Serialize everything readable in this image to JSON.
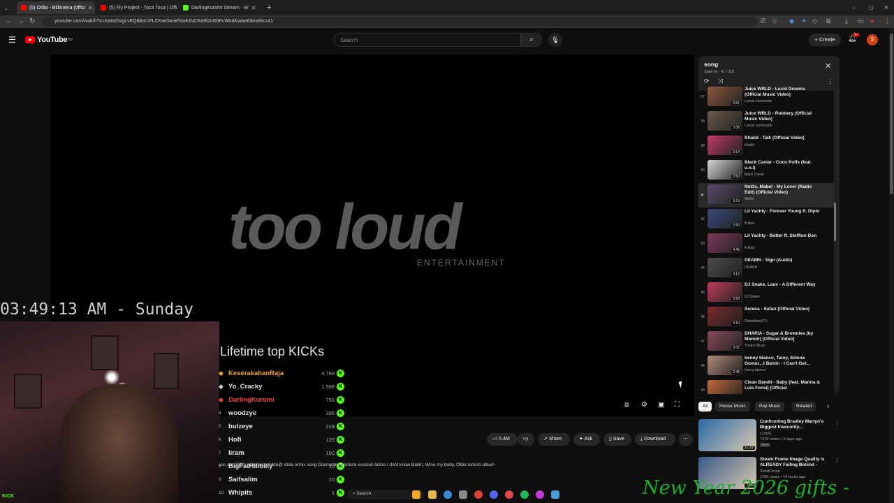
{
  "browser": {
    "tabs": [
      {
        "label": "(5) Otilia - Billionera (offici",
        "active": true,
        "color": "#ff0000"
      },
      {
        "label": "(5) Fly Project - Toca Toca | Offi",
        "active": false,
        "color": "#ff0000"
      },
      {
        "label": "DarlingKuromi Stream - W",
        "active": false,
        "color": "#53fc18"
      }
    ],
    "url": "youtube.com/watch?v=XataOVgLvEQ&list=PLCKwt34oefXwKINCRa9GoG5FcWk4KwAe6&index=41"
  },
  "header": {
    "logo_text": "YouTube",
    "logo_region": "BD",
    "search_placeholder": "Search",
    "create_label": "Create",
    "notification_count": "9+",
    "avatar_letter": "S"
  },
  "player": {
    "logo_main": "too loud",
    "logo_sub": "ENTERTAINMENT"
  },
  "overlay": {
    "clock": "03:49:13 AM - Sunday",
    "kick_tag": "KICK",
    "leaderboard_title": "Lifetime top KICKs",
    "leaderboard": [
      {
        "rank": "",
        "name": "KeserakahanRaja",
        "value": "4,768",
        "color": "#f5a623"
      },
      {
        "rank": "",
        "name": "Yo_Cracky",
        "value": "1,588",
        "color": "#e6e6e6"
      },
      {
        "rank": "",
        "name": "DarlingKuromi",
        "value": "756",
        "color": "#ff3b3b"
      },
      {
        "rank": "4",
        "name": "woodzye",
        "value": "396",
        "color": "#e6e6e6"
      },
      {
        "rank": "5",
        "name": "bulzeye",
        "value": "228",
        "color": "#e6e6e6"
      },
      {
        "rank": "6",
        "name": "Hofi",
        "value": "125",
        "color": "#e6e6e6"
      },
      {
        "rank": "7",
        "name": "Iiram",
        "value": "100",
        "color": "#e6e6e6"
      },
      {
        "rank": "8",
        "name": "BigFatHillbilly",
        "value": "10",
        "color": "#e6e6e6"
      },
      {
        "rank": "9",
        "name": "Saifsalim",
        "value": "10",
        "color": "#e6e6e6"
      },
      {
        "rank": "10",
        "name": "Whipits",
        "value": "1",
        "color": "#e6e6e6"
      }
    ],
    "new_year_text": "New Year 2026 gifts -"
  },
  "actions": {
    "likes": "5.4M",
    "share": "Share",
    "ask": "Ask",
    "save": "Save",
    "download": "Download"
  },
  "description_tags": "isic car 2020: billionaire Adda@ otilia remix song Diamante Aventura evocion latina I dont know Balim, Wine my body, Otilia turkish album",
  "playlist": {
    "title": "song",
    "subtitle": "Sajid sk - 41 / 101",
    "items": [
      {
        "num": "37",
        "title": "Juice WRLD - Lucid Dreams (Official Music Video)",
        "channel": "Lyrical Lemonade",
        "duration": "3:51",
        "color": "#8a5a3c"
      },
      {
        "num": "38",
        "title": "Juice WRLD - Robbery (Official Music Video)",
        "channel": "Lyrical Lemonade",
        "duration": "3:58",
        "color": "#6b5a4a"
      },
      {
        "num": "39",
        "title": "Khalid - Talk (Official Video)",
        "channel": "Khalid",
        "duration": "3:14",
        "color": "#c23a6a"
      },
      {
        "num": "40",
        "title": "Black Caviar - Coco Puffs (feat. u.n.i)",
        "channel": "Black Caviar",
        "duration": "2:50",
        "color": "#d8d8d8"
      },
      {
        "num": "▶",
        "title": "Not3s, Mabel - My Lover (Radio Edit) (Official Video)",
        "channel": "Not3s",
        "duration": "3:19",
        "color": "#5a4a6a"
      },
      {
        "num": "42",
        "title": "Lil Yachty - Forever Young ft. Diplo",
        "channel": "lil boat",
        "duration": "2:50",
        "color": "#3a4a7a"
      },
      {
        "num": "43",
        "title": "Lil Yachty - Better ft. Stefflon Don",
        "channel": "lil boat",
        "duration": "4:45",
        "color": "#7a3a5a"
      },
      {
        "num": "44",
        "title": "DEAMN - Sign (Audio)",
        "channel": "DEAMN",
        "duration": "3:12",
        "color": "#4a4a4a"
      },
      {
        "num": "45",
        "title": "DJ Snake, Lauv - A Different Way",
        "channel": "DJ Snake",
        "duration": "3:58",
        "color": "#c03a5a"
      },
      {
        "num": "46",
        "title": "Serena - Safari (Official Video)",
        "channel": "RotonMusicTV",
        "duration": "3:10",
        "color": "#7a2a2a"
      },
      {
        "num": "47",
        "title": "DHARIA - Sugar & Brownies (by Monoir) [Official Video]",
        "channel": "Thrace Music",
        "duration": "3:32",
        "color": "#8a4a5a"
      },
      {
        "num": "48",
        "title": "benny blanco, Tainy, Selena Gomez, J Balvin - I Can't Get...",
        "channel": "benny blanco",
        "duration": "2:45",
        "color": "#b08a7a"
      },
      {
        "num": "49",
        "title": "Clean Bandit - Baby (feat. Marina & Luis Fonsi) [Official",
        "channel": "",
        "duration": "",
        "color": "#c46a3a"
      }
    ]
  },
  "chips": [
    "All",
    "House Music",
    "Pop Music",
    "Related"
  ],
  "recommendations": [
    {
      "title": "Confronting Bradley Martyn's Biggest Insecurity...",
      "channel": "CONG",
      "meta": "747K views • 3 days ago",
      "badge": "New",
      "duration": "11:22",
      "color": "#2a6aa8"
    },
    {
      "title": "Steam Frame Image Quality is ALREADY Failing Behind -",
      "channel": "ShortCircuit",
      "meta": "176K views • 14 hours ago",
      "badge": "",
      "duration": "7:09",
      "color": "#3a5a8a"
    }
  ],
  "taskbar": {
    "search": "Search"
  }
}
